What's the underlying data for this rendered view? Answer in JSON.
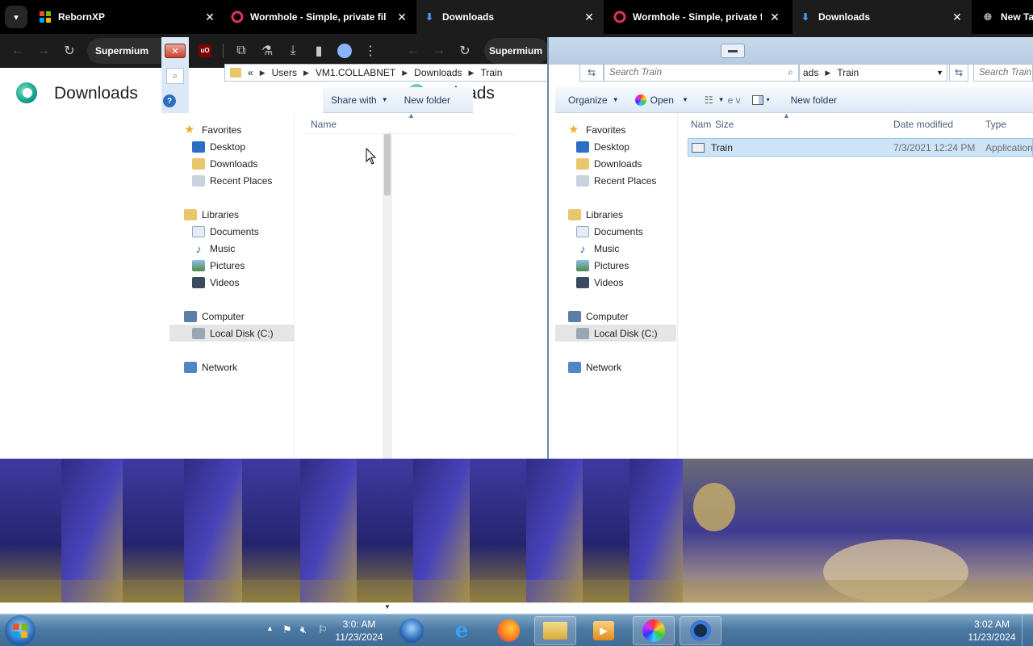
{
  "browser": {
    "tabs": [
      {
        "title": "RebornXP",
        "icon": "windows-flag-icon"
      },
      {
        "title": "Wormhole - Simple, private fil",
        "icon": "wormhole-icon"
      },
      {
        "title": "Downloads",
        "icon": "download-icon"
      },
      {
        "title": "Wormhole - Simple, private fil",
        "icon": "wormhole-icon"
      },
      {
        "title": "Downloads",
        "icon": "download-icon"
      },
      {
        "title": "New Tal",
        "icon": "globe-icon"
      }
    ],
    "left_omnibox": "Supermium",
    "right_omnibox": "Supermium"
  },
  "left_page": {
    "title": "Downloads",
    "faint_title": "nloads"
  },
  "explorer_left": {
    "address": {
      "prefix": "«",
      "crumbs": [
        "Users",
        "VM1.COLLABNET",
        "Downloads",
        "Train"
      ]
    },
    "commands": {
      "share_with": "Share with",
      "new_folder": "New folder"
    },
    "columns": {
      "name": "Name"
    },
    "nav": {
      "favorites": "Favorites",
      "desktop": "Desktop",
      "downloads": "Downloads",
      "recent": "Recent Places",
      "libraries": "Libraries",
      "documents": "Documents",
      "music": "Music",
      "pictures": "Pictures",
      "videos": "Videos",
      "computer": "Computer",
      "local_disk": "Local Disk (C:)",
      "network": "Network"
    }
  },
  "explorer_right": {
    "search_placeholder": "Search Train",
    "search_placeholder_far": "Search Train",
    "address": {
      "crumbs": [
        "ads",
        "Train"
      ]
    },
    "commands": {
      "organize": "Organize",
      "open": "Open",
      "view_partial": "e v",
      "new_folder": "New folder"
    },
    "columns": {
      "name": "Nam",
      "size": "Size",
      "date": "Date modified",
      "type": "Type"
    },
    "file": {
      "name": "Train",
      "date": "7/3/2021 12:24 PM",
      "type": "Application"
    },
    "nav": {
      "favorites": "Favorites",
      "desktop": "Desktop",
      "downloads": "Downloads",
      "recent": "Recent Places",
      "libraries": "Libraries",
      "documents": "Documents",
      "music": "Music",
      "pictures": "Pictures",
      "videos": "Videos",
      "computer": "Computer",
      "local_disk": "Local Disk (C:)",
      "network": "Network"
    }
  },
  "taskbar": {
    "clock_left": {
      "time": "3:0: AM",
      "date": "11/23/2024"
    },
    "clock_right": {
      "time": "3:02 AM",
      "date": "11/23/2024"
    }
  },
  "colors": {
    "tab_bg": "#000000",
    "toolbar_bg": "#1c1c1c",
    "explorer_selection": "#cde4f7",
    "taskbar": "#4d7aa3"
  }
}
